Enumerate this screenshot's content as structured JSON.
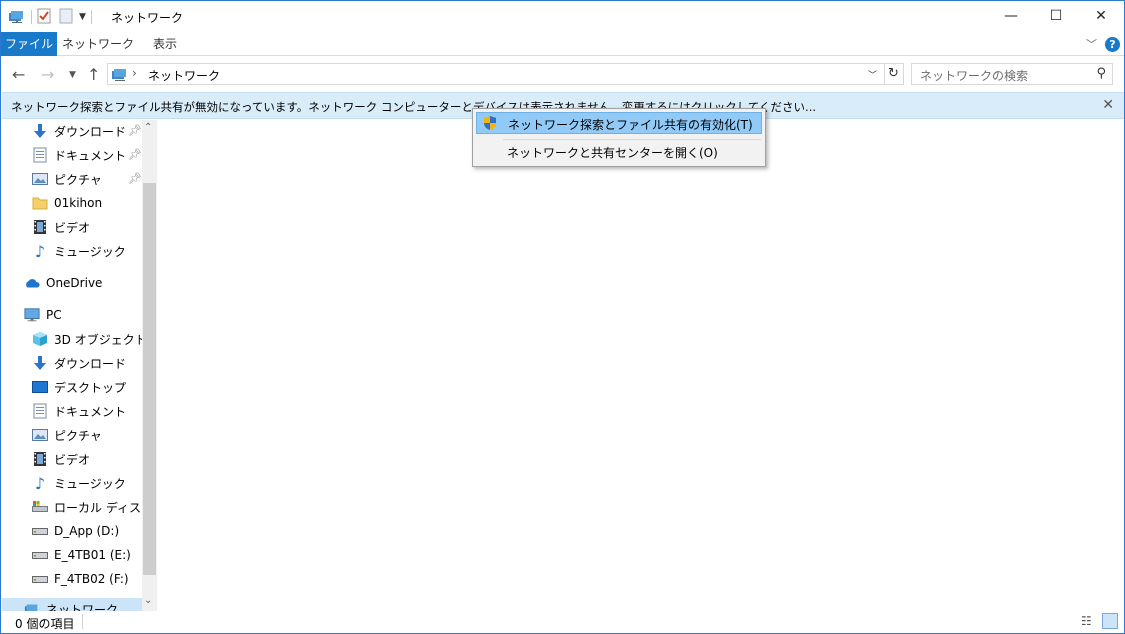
{
  "window": {
    "title": "ネットワーク",
    "minimize": "—",
    "maximize": "☐",
    "close": "✕"
  },
  "ribbon": {
    "tabs": [
      "ファイル",
      "ネットワーク",
      "表示"
    ]
  },
  "address": {
    "path": "ネットワーク",
    "search_placeholder": "ネットワークの検索"
  },
  "infobar": {
    "message": "ネットワーク探索とファイル共有が無効になっています。ネットワーク コンピューターとデバイスは表示されません。変更するにはクリックしてください..."
  },
  "context_menu": {
    "items": [
      "ネットワーク探索とファイル共有の有効化(T)",
      "ネットワークと共有センターを開く(O)"
    ]
  },
  "nav_pane": {
    "quick_access": [
      {
        "label": "ダウンロード",
        "icon": "download-icon",
        "pinned": true
      },
      {
        "label": "ドキュメント",
        "icon": "document-icon",
        "pinned": true
      },
      {
        "label": "ピクチャ",
        "icon": "pictures-icon",
        "pinned": true
      },
      {
        "label": "01kihon",
        "icon": "folder-icon",
        "pinned": false
      },
      {
        "label": "ビデオ",
        "icon": "video-icon",
        "pinned": false
      },
      {
        "label": "ミュージック",
        "icon": "music-icon",
        "pinned": false
      }
    ],
    "onedrive": "OneDrive",
    "pc": "PC",
    "pc_items": [
      {
        "label": "3D オブジェクト",
        "icon": "3d-objects-icon"
      },
      {
        "label": "ダウンロード",
        "icon": "download-icon"
      },
      {
        "label": "デスクトップ",
        "icon": "desktop-icon"
      },
      {
        "label": "ドキュメント",
        "icon": "document-icon"
      },
      {
        "label": "ピクチャ",
        "icon": "pictures-icon"
      },
      {
        "label": "ビデオ",
        "icon": "video-icon"
      },
      {
        "label": "ミュージック",
        "icon": "music-icon"
      },
      {
        "label": "ローカル ディスク (C",
        "icon": "local-disk-icon"
      },
      {
        "label": "D_App (D:)",
        "icon": "drive-icon"
      },
      {
        "label": "E_4TB01 (E:)",
        "icon": "drive-icon"
      },
      {
        "label": "F_4TB02 (F:)",
        "icon": "drive-icon"
      }
    ],
    "network": "ネットワーク"
  },
  "status": {
    "items": "0 個の項目"
  },
  "colors": {
    "accent": "#1979ca",
    "infobar_bg": "#d9ecf9",
    "menu_highlight": "#91c9f7"
  }
}
